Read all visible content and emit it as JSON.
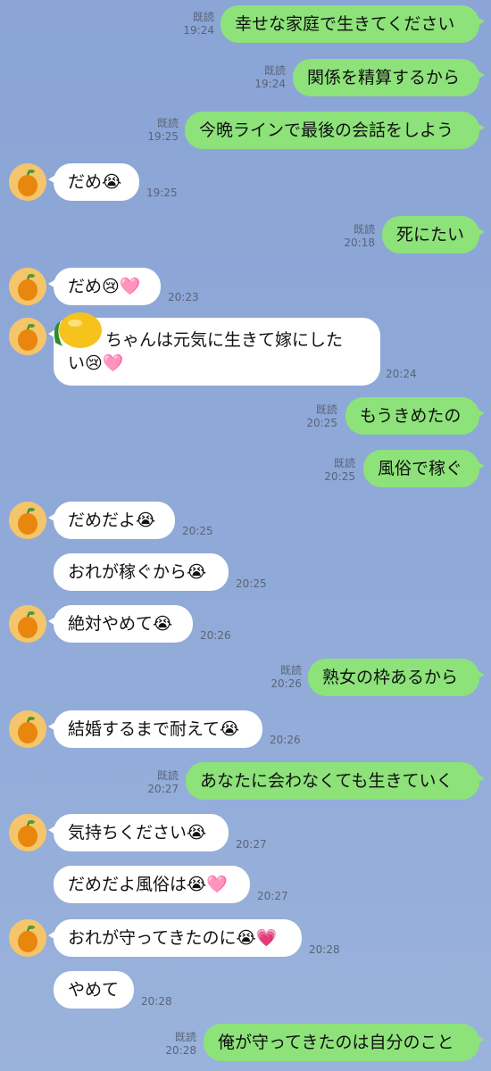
{
  "messages": [
    {
      "dir": "out",
      "text": "幸せな家庭で生きてください",
      "read": "既読",
      "time": "19:24"
    },
    {
      "dir": "out",
      "text": "関係を精算するから",
      "read": "既読",
      "time": "19:24"
    },
    {
      "dir": "out",
      "text": "今晩ラインで最後の会話をしよう",
      "read": "既読",
      "time": "19:25"
    },
    {
      "dir": "in",
      "text": "だめ😭",
      "time": "19:25"
    },
    {
      "dir": "out",
      "text": "死にたい",
      "read": "既読",
      "time": "20:18"
    },
    {
      "dir": "in",
      "text": "だめ😢🩷",
      "time": "20:23"
    },
    {
      "dir": "in",
      "line1": "ちゃんは元気に生きて嫁にした",
      "line2": "い😢🩷",
      "time": "20:24"
    },
    {
      "dir": "out",
      "text": "もうきめたの",
      "read": "既読",
      "time": "20:25"
    },
    {
      "dir": "out",
      "text": "風俗で稼ぐ",
      "read": "既読",
      "time": "20:25"
    },
    {
      "dir": "in",
      "text": "だめだよ😭",
      "time": "20:25"
    },
    {
      "dir": "in",
      "text": "おれが稼ぐから😭",
      "time": "20:25"
    },
    {
      "dir": "in",
      "text": "絶対やめて😭",
      "time": "20:26"
    },
    {
      "dir": "out",
      "text": "熟女の枠あるから",
      "read": "既読",
      "time": "20:26"
    },
    {
      "dir": "in",
      "text": "結婚するまで耐えて😭",
      "time": "20:26"
    },
    {
      "dir": "out",
      "text": "あなたに会わなくても生きていく",
      "read": "既読",
      "time": "20:27"
    },
    {
      "dir": "in",
      "text": "気持ちください😭",
      "time": "20:27"
    },
    {
      "dir": "in",
      "text": "だめだよ風俗は😭🩷",
      "time": "20:27"
    },
    {
      "dir": "in",
      "text": "おれが守ってきたのに😭💗",
      "time": "20:28"
    },
    {
      "dir": "in",
      "text": "やめて",
      "time": "20:28"
    },
    {
      "dir": "out",
      "text": "俺が守ってきたのは自分のこと",
      "read": "既読",
      "time": "20:28"
    }
  ]
}
